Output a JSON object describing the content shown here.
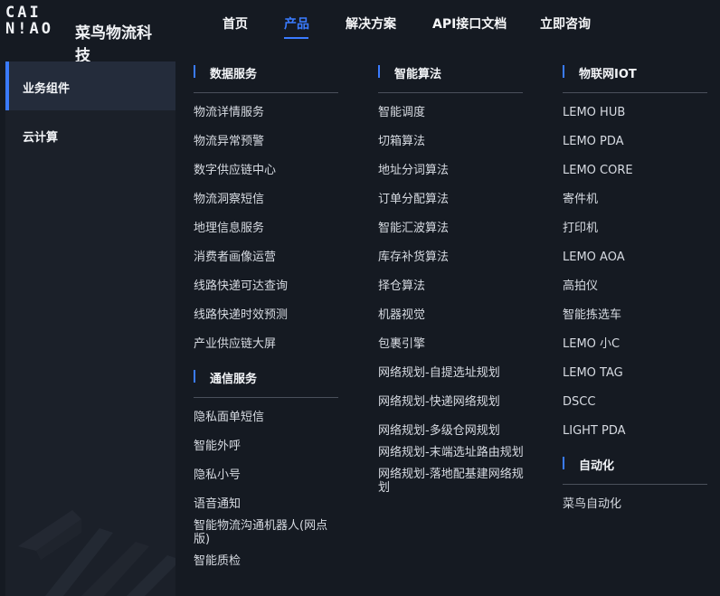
{
  "brand": {
    "logo_en": "CAI\nN!AO",
    "logo_cn": "菜鸟物流科技"
  },
  "nav": [
    "首页",
    "产品",
    "解决方案",
    "API接口文档",
    "立即咨询"
  ],
  "nav_active": "产品",
  "sidebar": [
    "业务组件",
    "云计算"
  ],
  "columns": {
    "data_service": {
      "title": "数据服务",
      "items": [
        "物流详情服务",
        "物流异常预警",
        "数字供应链中心",
        "物流洞察短信",
        "地理信息服务",
        "消费者画像运营",
        "线路快递可达查询",
        "线路快递时效预测",
        "产业供应链大屏"
      ]
    },
    "comm_service": {
      "title": "通信服务",
      "items": [
        "隐私面单短信",
        "智能外呼",
        "隐私小号",
        "语音通知",
        "智能物流沟通机器人(网点版)",
        "智能质检"
      ]
    },
    "smart_algo": {
      "title": "智能算法",
      "items": [
        "智能调度",
        "切箱算法",
        "地址分词算法",
        "订单分配算法",
        "智能汇波算法",
        "库存补货算法",
        "择仓算法",
        "机器视觉",
        "包裹引擎",
        "网络规划-自提选址规划",
        "网络规划-快递网络规划",
        "网络规划-多级仓网规划",
        "网络规划-末端选址路由规划",
        "网络规划-落地配基建网络规划"
      ]
    },
    "iot": {
      "title": "物联网IOT",
      "items": [
        "LEMO HUB",
        "LEMO PDA",
        "LEMO CORE",
        "寄件机",
        "打印机",
        "LEMO AOA",
        "高拍仪",
        "智能拣选车",
        "LEMO 小C",
        "LEMO TAG",
        "DSCC",
        "LIGHT PDA"
      ]
    },
    "automation": {
      "title": "自动化",
      "items": [
        "菜鸟自动化"
      ]
    }
  },
  "colors": {
    "accent": "#3a7bff",
    "background": "#151a22",
    "sidebar": "#1b2029"
  }
}
